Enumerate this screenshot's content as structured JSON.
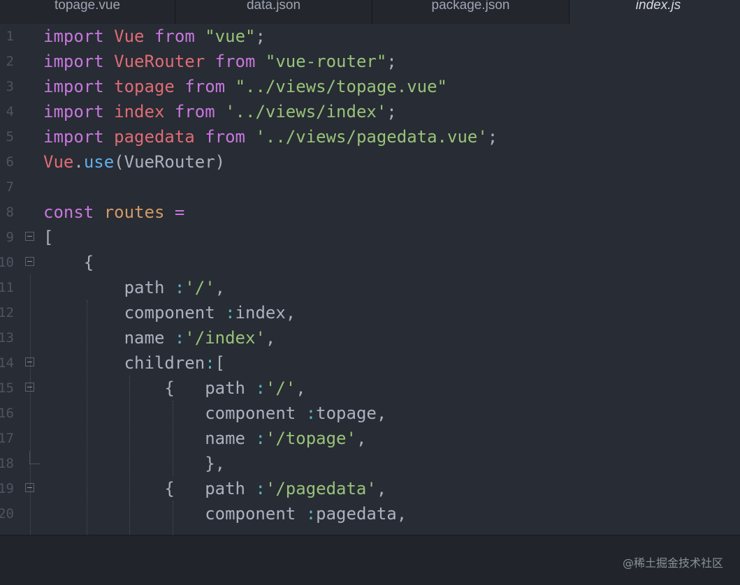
{
  "tabs": [
    {
      "label": "topage.vue",
      "active": false
    },
    {
      "label": "data.json",
      "active": false
    },
    {
      "label": "package.json",
      "active": false
    },
    {
      "label": "index.js",
      "active": true
    }
  ],
  "lines": [
    {
      "n": "1",
      "tokens": [
        {
          "t": "import",
          "c": "kw"
        },
        {
          "t": " "
        },
        {
          "t": "Vue",
          "c": "id"
        },
        {
          "t": " "
        },
        {
          "t": "from",
          "c": "kw"
        },
        {
          "t": " "
        },
        {
          "t": "\"vue\"",
          "c": "str"
        },
        {
          "t": ";",
          "c": "pl"
        }
      ]
    },
    {
      "n": "2",
      "tokens": [
        {
          "t": "import",
          "c": "kw"
        },
        {
          "t": " "
        },
        {
          "t": "VueRouter",
          "c": "id"
        },
        {
          "t": " "
        },
        {
          "t": "from",
          "c": "kw"
        },
        {
          "t": " "
        },
        {
          "t": "\"vue-router\"",
          "c": "str"
        },
        {
          "t": ";",
          "c": "pl"
        }
      ]
    },
    {
      "n": "3",
      "tokens": [
        {
          "t": "import",
          "c": "kw"
        },
        {
          "t": " "
        },
        {
          "t": "topage",
          "c": "id"
        },
        {
          "t": " "
        },
        {
          "t": "from",
          "c": "kw"
        },
        {
          "t": " "
        },
        {
          "t": "\"../views/topage.vue\"",
          "c": "str"
        }
      ]
    },
    {
      "n": "4",
      "tokens": [
        {
          "t": "import",
          "c": "kw"
        },
        {
          "t": " "
        },
        {
          "t": "index",
          "c": "id"
        },
        {
          "t": " "
        },
        {
          "t": "from",
          "c": "kw"
        },
        {
          "t": " "
        },
        {
          "t": "'../views/index'",
          "c": "str"
        },
        {
          "t": ";",
          "c": "pl"
        }
      ]
    },
    {
      "n": "5",
      "tokens": [
        {
          "t": "import",
          "c": "kw"
        },
        {
          "t": " "
        },
        {
          "t": "pagedata",
          "c": "id"
        },
        {
          "t": " "
        },
        {
          "t": "from",
          "c": "kw"
        },
        {
          "t": " "
        },
        {
          "t": "'../views/pagedata.vue'",
          "c": "str"
        },
        {
          "t": ";",
          "c": "pl"
        }
      ]
    },
    {
      "n": "6",
      "tokens": [
        {
          "t": "Vue",
          "c": "id"
        },
        {
          "t": ".",
          "c": "pl"
        },
        {
          "t": "use",
          "c": "fn"
        },
        {
          "t": "(VueRouter)",
          "c": "pl"
        }
      ]
    },
    {
      "n": "7",
      "tokens": []
    },
    {
      "n": "8",
      "tokens": [
        {
          "t": "const",
          "c": "kw"
        },
        {
          "t": " "
        },
        {
          "t": "routes",
          "c": "var"
        },
        {
          "t": " "
        },
        {
          "t": "=",
          "c": "kw"
        }
      ]
    },
    {
      "n": "9",
      "fold": true,
      "tokens": [
        {
          "t": "[",
          "c": "pl"
        }
      ]
    },
    {
      "n": "10",
      "fold": true,
      "tokens": [
        {
          "t": "    {",
          "c": "pl"
        }
      ]
    },
    {
      "n": "11",
      "tokens": [
        {
          "t": "        path ",
          "c": "pl"
        },
        {
          "t": ":",
          "c": "op"
        },
        {
          "t": "'/'",
          "c": "str"
        },
        {
          "t": ",",
          "c": "pl"
        }
      ]
    },
    {
      "n": "12",
      "tokens": [
        {
          "t": "        component ",
          "c": "pl"
        },
        {
          "t": ":",
          "c": "op"
        },
        {
          "t": "index,",
          "c": "pl"
        }
      ]
    },
    {
      "n": "13",
      "tokens": [
        {
          "t": "        name ",
          "c": "pl"
        },
        {
          "t": ":",
          "c": "op"
        },
        {
          "t": "'/index'",
          "c": "str"
        },
        {
          "t": ",",
          "c": "pl"
        }
      ]
    },
    {
      "n": "14",
      "fold": true,
      "tokens": [
        {
          "t": "        children",
          "c": "pl"
        },
        {
          "t": ":",
          "c": "op"
        },
        {
          "t": "[",
          "c": "pl"
        }
      ]
    },
    {
      "n": "15",
      "fold": true,
      "tokens": [
        {
          "t": "            {   path ",
          "c": "pl"
        },
        {
          "t": ":",
          "c": "op"
        },
        {
          "t": "'/'",
          "c": "str"
        },
        {
          "t": ",",
          "c": "pl"
        }
      ]
    },
    {
      "n": "16",
      "tokens": [
        {
          "t": "                component ",
          "c": "pl"
        },
        {
          "t": ":",
          "c": "op"
        },
        {
          "t": "topage,",
          "c": "pl"
        }
      ]
    },
    {
      "n": "17",
      "tokens": [
        {
          "t": "                name ",
          "c": "pl"
        },
        {
          "t": ":",
          "c": "op"
        },
        {
          "t": "'/topage'",
          "c": "str"
        },
        {
          "t": ",",
          "c": "pl"
        }
      ]
    },
    {
      "n": "18",
      "foldend": true,
      "tokens": [
        {
          "t": "                },",
          "c": "pl"
        }
      ]
    },
    {
      "n": "19",
      "fold": true,
      "tokens": [
        {
          "t": "            {   path ",
          "c": "pl"
        },
        {
          "t": ":",
          "c": "op"
        },
        {
          "t": "'/pagedata'",
          "c": "str"
        },
        {
          "t": ",",
          "c": "pl"
        }
      ]
    },
    {
      "n": "20",
      "tokens": [
        {
          "t": "                component ",
          "c": "pl"
        },
        {
          "t": ":",
          "c": "op"
        },
        {
          "t": "pagedata,",
          "c": "pl"
        }
      ]
    }
  ],
  "watermark": "@稀土掘金技术社区",
  "colors": {
    "keyword": "#c678dd",
    "identifier": "#e06c75",
    "string": "#98c379",
    "function": "#61afef",
    "variable": "#d19a66",
    "operator": "#56b6c2",
    "plain": "#abb2bf",
    "background": "#282c34"
  }
}
